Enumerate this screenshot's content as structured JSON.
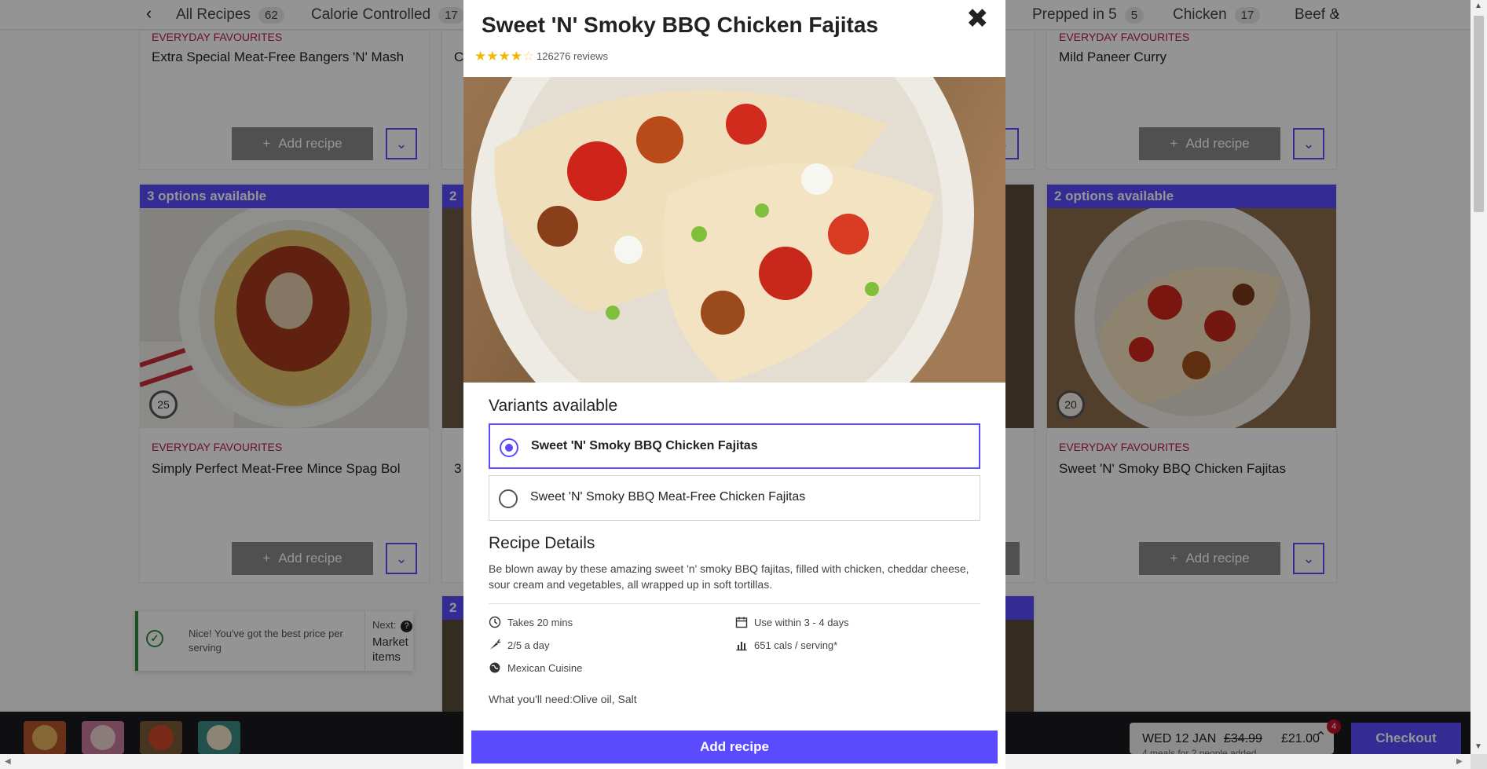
{
  "filter_bar": {
    "chips": [
      {
        "label": "All Recipes",
        "count": "62"
      },
      {
        "label": "Calorie Controlled",
        "count": "17"
      },
      {
        "label": "Prepped in 5",
        "count": "5"
      },
      {
        "label": "Chicken",
        "count": "17"
      },
      {
        "label": "Beef &"
      }
    ],
    "prev_arrow": "‹",
    "next_arrow": "›"
  },
  "background_cards": [
    {
      "category": "EVERYDAY FAVOURITES",
      "title": "Extra Special Meat-Free Bangers 'N' Mash",
      "add_label": "Add recipe"
    },
    {
      "category": "EVERYDAY FAVOURITES",
      "title": "Mild Paneer Curry",
      "add_label": "Add recipe"
    },
    {
      "options": "3 options available",
      "timer": "25",
      "category": "EVERYDAY FAVOURITES",
      "title": "Simply Perfect Meat-Free Mince Spag Bol",
      "add_label": "Add recipe"
    },
    {
      "options": "2 options available",
      "timer": "20",
      "category": "EVERYDAY FAVOURITES",
      "title": "Sweet 'N' Smoky BBQ Chicken Fajitas",
      "add_label": "Add recipe"
    }
  ],
  "partial_fragments": {
    "c": "C",
    "two": "2",
    "three": "3"
  },
  "toast": {
    "message": "Nice! You've got the best price per serving",
    "next_label": "Next:",
    "next_target": "Market items"
  },
  "bottom_bar": {
    "date": "WED 12 JAN",
    "old_price": "£34.99",
    "new_price": "£21.00",
    "subtitle": "4 meals for 2 people added",
    "badge_count": "4",
    "checkout_label": "Checkout"
  },
  "modal": {
    "title": "Sweet 'N' Smoky BBQ Chicken Fajitas",
    "rating": 4.5,
    "reviews": "126276 reviews",
    "variants_heading": "Variants available",
    "variants": [
      {
        "label": "Sweet 'N' Smoky BBQ Chicken Fajitas",
        "selected": true
      },
      {
        "label": "Sweet 'N' Smoky BBQ Meat-Free Chicken Fajitas",
        "selected": false
      }
    ],
    "details_heading": "Recipe Details",
    "description": "Be blown away by these amazing sweet 'n' smoky BBQ fajitas, filled with chicken, cheddar cheese, sour cream and vegetables, all wrapped up in soft tortillas.",
    "facts": {
      "time": "Takes 20 mins",
      "use_within": "Use within 3 - 4 days",
      "five_a_day": "2/5 a day",
      "calories": "651 cals / serving*",
      "cuisine": "Mexican Cuisine"
    },
    "need": "What you'll need:Olive oil, Salt",
    "add_label": "Add recipe",
    "close_glyph": "✖"
  },
  "colors": {
    "accent": "#5a4bff",
    "category": "#b8185a",
    "star": "#f2b705",
    "success": "#2e8b3e",
    "dark_bar": "#1b1b1f"
  },
  "icons": [
    "chevron-left-icon",
    "chevron-right-icon",
    "plus-icon",
    "chevron-down-icon",
    "close-icon",
    "star-icon",
    "clock-icon",
    "calendar-icon",
    "carrot-icon",
    "chart-icon",
    "globe-icon",
    "check-icon",
    "question-icon",
    "chevron-up-icon"
  ]
}
